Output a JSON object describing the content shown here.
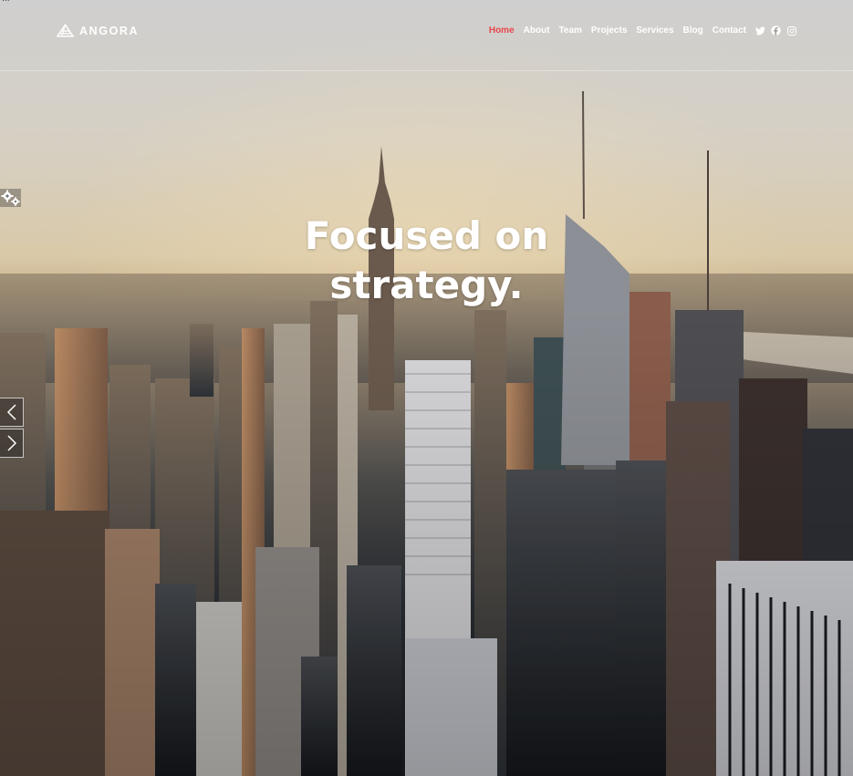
{
  "brand": {
    "name": "ANGORA",
    "logo_icon": "angora-logo-icon"
  },
  "nav": {
    "items": [
      {
        "label": "Home",
        "active": true
      },
      {
        "label": "About",
        "active": false
      },
      {
        "label": "Team",
        "active": false
      },
      {
        "label": "Projects",
        "active": false
      },
      {
        "label": "Services",
        "active": false
      },
      {
        "label": "Blog",
        "active": false
      },
      {
        "label": "Contact",
        "active": false
      }
    ],
    "social": [
      "twitter-icon",
      "facebook-icon",
      "instagram-icon"
    ],
    "active_color": "#e8474b"
  },
  "hero": {
    "headline_line1": "Focused on",
    "headline_line2": "strategy.",
    "prev_icon": "chevron-left-icon",
    "next_icon": "chevron-right-icon"
  },
  "widgets": {
    "settings_icon": "gears-icon"
  },
  "corner_text": "..."
}
